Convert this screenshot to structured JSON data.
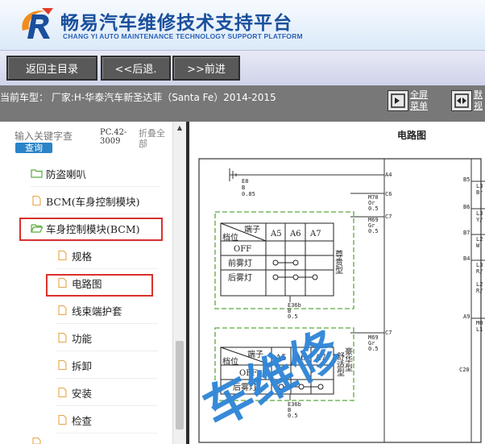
{
  "header": {
    "logo_icon": "cy-logo-icon",
    "title": "畅易汽车维修技术支持平台",
    "subtitle": "CHANG YI AUTO MAINTENANCE TECHNOLOGY SUPPORT PLATFORM"
  },
  "nav": {
    "home": "返回主目录",
    "back": "<<后退.",
    "forward": ">>前进"
  },
  "vehicle": {
    "text": "当前车型：  厂家:H-华泰汽车新圣达菲（Santa Fe）2014-2015"
  },
  "tools": {
    "fullscreen_line1": "全屏",
    "fullscreen_line2": "菜单",
    "second_line1": "默",
    "second_line2": "视"
  },
  "sidebar": {
    "search_placeholder": "输入关键字查",
    "search_button": "查询",
    "pc_code": "PC.42-3009",
    "collapse_all": "折叠全部",
    "items": [
      {
        "label": "防盗喇叭",
        "icon": "folder-icon"
      },
      {
        "label": "BCM(车身控制模块)",
        "icon": "document-icon"
      },
      {
        "label": "车身控制模块(BCM)",
        "icon": "folder-open-icon"
      },
      {
        "label": "规格",
        "icon": "document-icon"
      },
      {
        "label": "电路图",
        "icon": "document-icon"
      },
      {
        "label": "线束端护套",
        "icon": "document-icon"
      },
      {
        "label": "功能",
        "icon": "document-icon"
      },
      {
        "label": "拆卸",
        "icon": "document-icon"
      },
      {
        "label": "安装",
        "icon": "document-icon"
      },
      {
        "label": "检查",
        "icon": "document-icon"
      }
    ]
  },
  "doc": {
    "title": "电路图",
    "watermark": "车维修",
    "labels": {
      "a4": "A4",
      "c6": "C6",
      "c7": "C7",
      "e8": "E8",
      "b": "B",
      "w085": "0.85",
      "m70": "M70",
      "or": "Or",
      "v05": "0.5",
      "m69": "M69",
      "gr": "Gr",
      "duanzi": "端子",
      "dangwei": "档位",
      "a5": "A5",
      "a6": "A6",
      "a7": "A7",
      "off": "OFF",
      "qianwudeng": "前雾灯",
      "houwudeng": "后雾灯",
      "zunguixing": "尊贵型",
      "shushixing": "舒适型",
      "haohuaxing": "豪华型",
      "e36b": "E36b",
      "b5": "B5",
      "b6": "B6",
      "b7": "B7",
      "b4": "B4",
      "a9": "A9",
      "c20": "C20",
      "l3": "L3",
      "br": "Br",
      "y": "Y/",
      "l2": "L2",
      "w": "W",
      "r": "R/",
      "mo": "MO",
      "l1": "L1"
    }
  }
}
